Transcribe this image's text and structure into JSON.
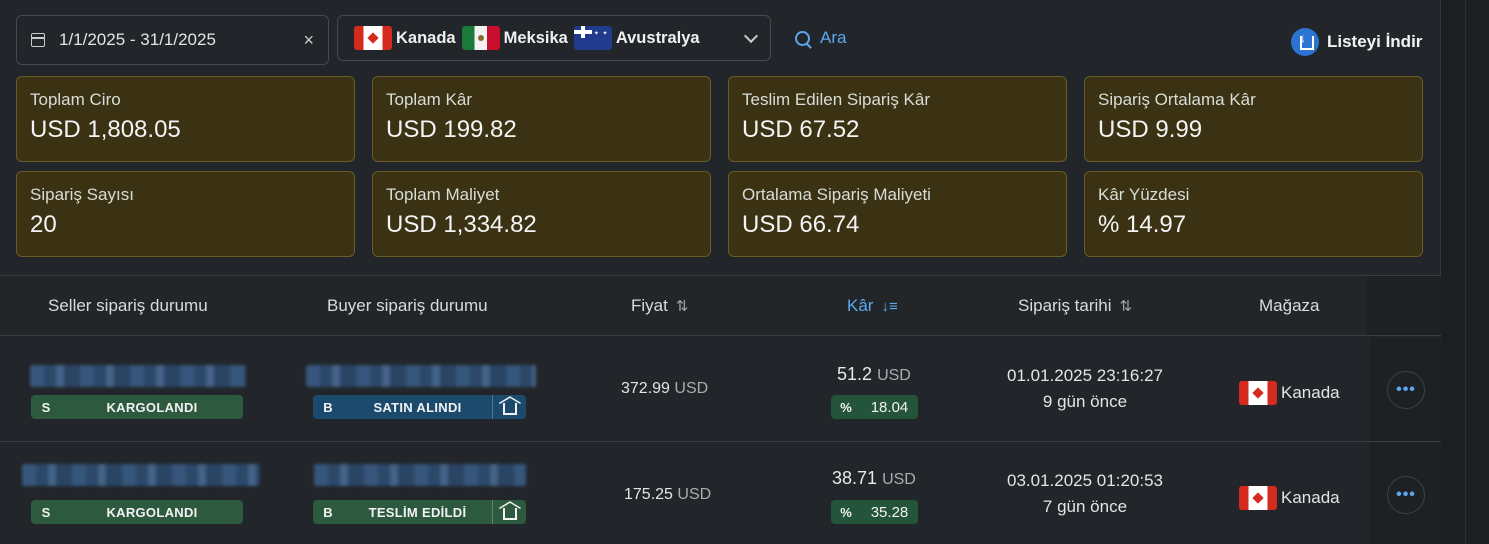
{
  "filters": {
    "date_range": "1/1/2025 - 31/1/2025",
    "clear_icon": "×",
    "countries": [
      {
        "name": "Kanada",
        "flag": "ca"
      },
      {
        "name": "Meksika",
        "flag": "mx"
      },
      {
        "name": "Avustralya",
        "flag": "au"
      }
    ],
    "search_label": "Ara",
    "download_label": "Listeyi İndir"
  },
  "stats": [
    {
      "label": "Toplam Ciro",
      "value": "USD 1,808.05"
    },
    {
      "label": "Toplam Kâr",
      "value": "USD 199.82"
    },
    {
      "label": "Teslim Edilen Sipariş Kâr",
      "value": "USD 67.52"
    },
    {
      "label": "Sipariş Ortalama Kâr",
      "value": "USD 9.99"
    },
    {
      "label": "Sipariş Sayısı",
      "value": "20"
    },
    {
      "label": "Toplam Maliyet",
      "value": "USD 1,334.82"
    },
    {
      "label": "Ortalama Sipariş Maliyeti",
      "value": "USD 66.74"
    },
    {
      "label": "Kâr Yüzdesi",
      "value": "% 14.97"
    }
  ],
  "table": {
    "columns": {
      "seller_status": "Seller sipariş durumu",
      "buyer_status": "Buyer sipariş durumu",
      "price": "Fiyat",
      "profit": "Kâr",
      "order_date": "Sipariş tarihi",
      "store": "Mağaza"
    },
    "sort_icon": "⇅",
    "sort_active_icon": "↓≡",
    "rows": [
      {
        "seller_letter": "S",
        "seller_status": "KARGOLANDI",
        "buyer_letter": "B",
        "buyer_status": "SATIN ALINDI",
        "price": "372.99",
        "price_currency": "USD",
        "profit": "51.2",
        "profit_currency": "USD",
        "pct_sign": "%",
        "pct": "18.04",
        "date": "01.01.2025 23:16:27",
        "ago": "9 gün önce",
        "store": "Kanada",
        "more": "•••"
      },
      {
        "seller_letter": "S",
        "seller_status": "KARGOLANDI",
        "buyer_letter": "B",
        "buyer_status": "TESLİM EDİLDİ",
        "price": "175.25",
        "price_currency": "USD",
        "profit": "38.71",
        "profit_currency": "USD",
        "pct_sign": "%",
        "pct": "35.28",
        "date": "03.01.2025 01:20:53",
        "ago": "7 gün önce",
        "store": "Kanada",
        "more": "•••"
      }
    ]
  },
  "colors": {
    "accent": "#5aa8ef",
    "card_bg": "#3a3213",
    "badge_green": "#2d5a3e",
    "badge_blue": "#1c4a6d"
  }
}
